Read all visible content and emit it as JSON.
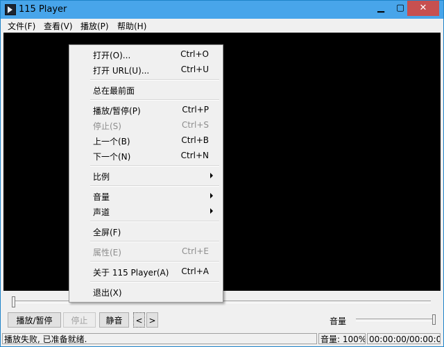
{
  "window": {
    "title": "115 Player"
  },
  "menubar": {
    "items": [
      "文件(F)",
      "查看(V)",
      "播放(P)",
      "帮助(H)"
    ]
  },
  "context_menu": {
    "items": [
      {
        "label": "打开(O)...",
        "shortcut": "Ctrl+O"
      },
      {
        "label": "打开 URL(U)...",
        "shortcut": "Ctrl+U"
      },
      {
        "label": "总在最前面"
      },
      {
        "label": "播放/暂停(P)",
        "shortcut": "Ctrl+P"
      },
      {
        "label": "停止(S)",
        "shortcut": "Ctrl+S"
      },
      {
        "label": "上一个(B)",
        "shortcut": "Ctrl+B"
      },
      {
        "label": "下一个(N)",
        "shortcut": "Ctrl+N"
      },
      {
        "label": "比例"
      },
      {
        "label": "音量"
      },
      {
        "label": "声道"
      },
      {
        "label": "全屏(F)"
      },
      {
        "label": "属性(E)",
        "shortcut": "Ctrl+E"
      },
      {
        "label": "关于 115 Player(A)",
        "shortcut": "Ctrl+A"
      },
      {
        "label": "退出(X)"
      }
    ]
  },
  "controls": {
    "play_pause": "播放/暂停",
    "stop": "停止",
    "mute": "静音",
    "prev": "<",
    "next": ">",
    "volume_label": "音量"
  },
  "seek": {
    "progress": 0
  },
  "volume": {
    "level": 1.0
  },
  "status": {
    "message": "播放失败, 已准备就绪.",
    "volume": "音量: 100%",
    "time": "00:00:00/00:00:00"
  }
}
